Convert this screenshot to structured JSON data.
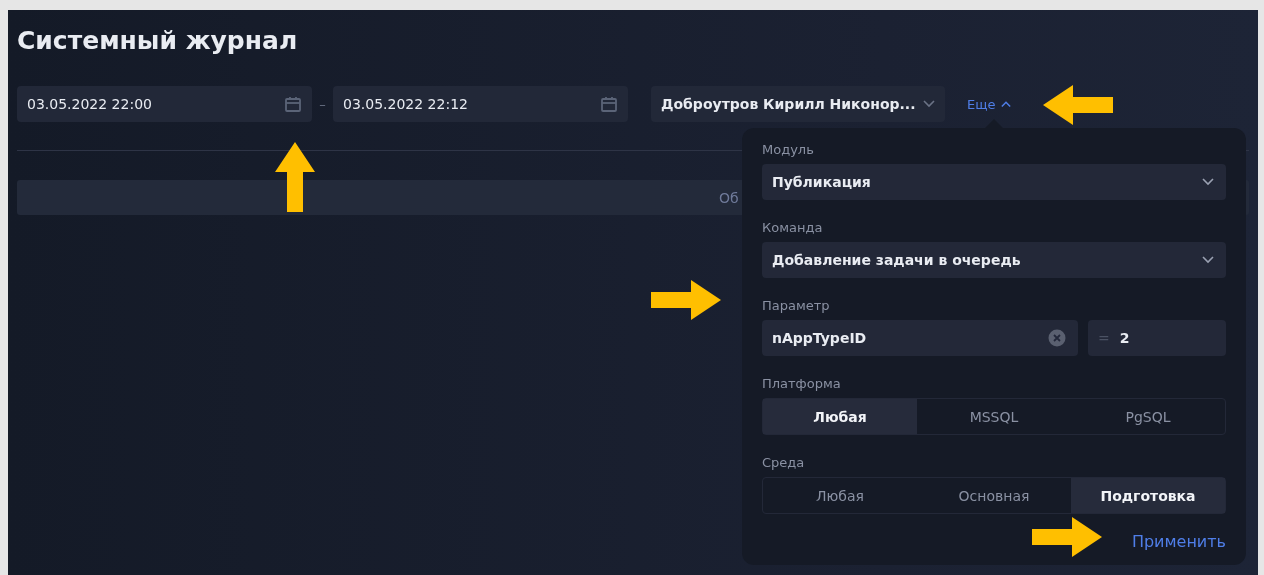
{
  "title": "Системный журнал",
  "filters": {
    "date_from": "03.05.2022 22:00",
    "separator": "–",
    "date_to": "03.05.2022 22:12",
    "user": "Доброутров Кирилл Никонор...",
    "more_link": "Еще",
    "more_expanded": true
  },
  "table_header": {
    "text": "Об"
  },
  "popover": {
    "module": {
      "label": "Модуль",
      "value": "Публикация"
    },
    "command": {
      "label": "Команда",
      "value": "Добавление задачи в очередь"
    },
    "parameter": {
      "label": "Параметр",
      "name": "nAppTypeID",
      "operator": "=",
      "value": "2"
    },
    "platform": {
      "label": "Платформа",
      "options": [
        {
          "label": "Любая",
          "selected": true
        },
        {
          "label": "MSSQL",
          "selected": false
        },
        {
          "label": "PgSQL",
          "selected": false
        }
      ]
    },
    "environment": {
      "label": "Среда",
      "options": [
        {
          "label": "Любая",
          "selected": false
        },
        {
          "label": "Основная",
          "selected": false
        },
        {
          "label": "Подготовка",
          "selected": true
        }
      ]
    },
    "apply": "Применить"
  },
  "annotations": [
    {
      "kind": "up"
    },
    {
      "kind": "left"
    },
    {
      "kind": "right"
    },
    {
      "kind": "right"
    }
  ]
}
